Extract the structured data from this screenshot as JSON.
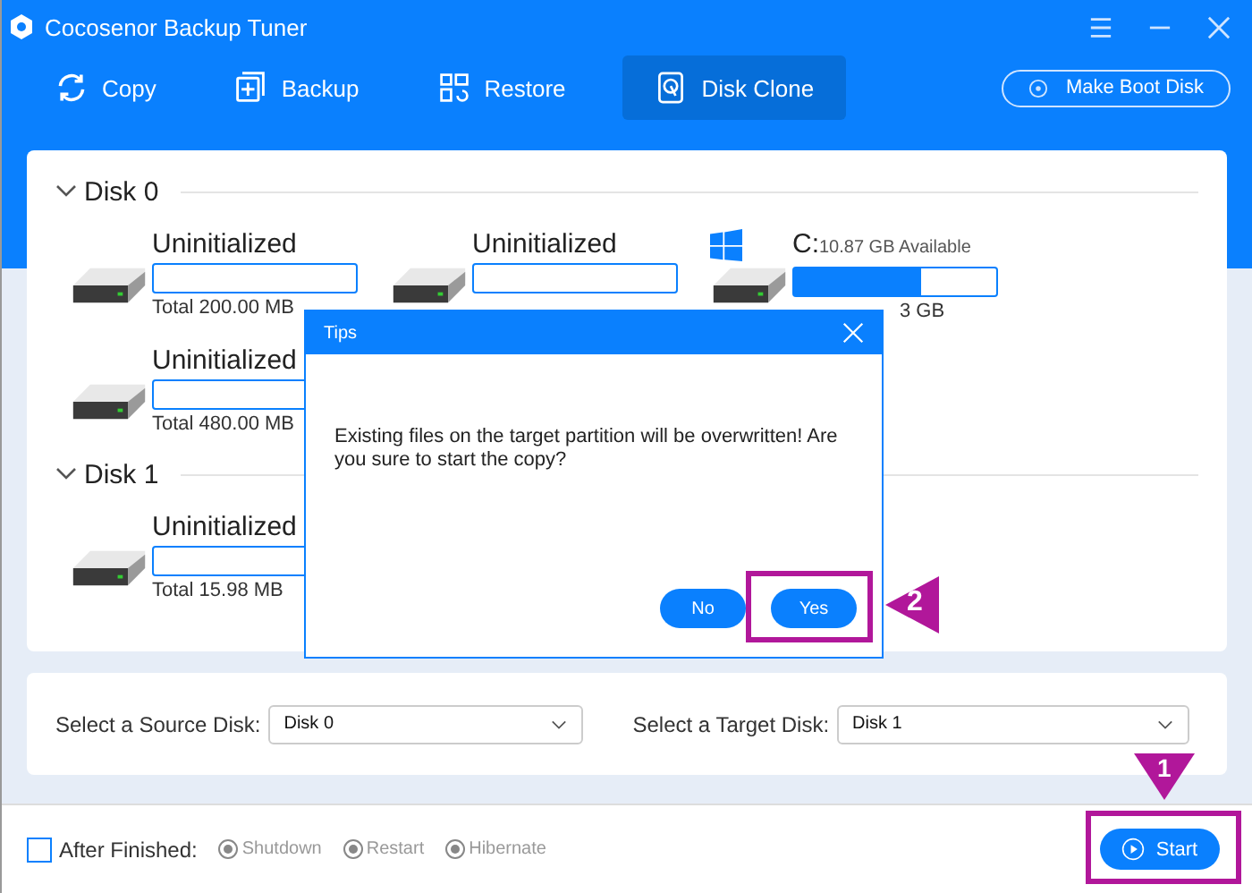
{
  "window": {
    "title": "Cocosenor Backup Tuner"
  },
  "tabs": [
    {
      "label": "Copy",
      "selected": false
    },
    {
      "label": "Backup",
      "selected": false
    },
    {
      "label": "Restore",
      "selected": false
    },
    {
      "label": "Disk Clone",
      "selected": true
    }
  ],
  "boot_button": "Make Boot Disk",
  "disks": [
    {
      "title": "Disk 0",
      "expanded": true,
      "partitions": [
        {
          "kind": "uninitialized",
          "name": "Uninitialized",
          "total": "Total 200.00 MB"
        },
        {
          "kind": "uninitialized",
          "name": "Uninitialized"
        },
        {
          "kind": "system",
          "name": "C:",
          "available": "10.87 GB Available",
          "level": 0.63,
          "total": "3 GB"
        },
        {
          "kind": "uninitialized",
          "name": "Uninitialized",
          "total": "Total 480.00 MB"
        }
      ]
    },
    {
      "title": "Disk 1",
      "expanded": true,
      "partitions": [
        {
          "kind": "uninitialized",
          "name": "Uninitialized",
          "total": "Total 15.98 MB"
        }
      ]
    }
  ],
  "selectors": [
    {
      "label": "Select a Source Disk:",
      "value": "Disk 0"
    },
    {
      "label": "Select a Target Disk:",
      "value": "Disk 1"
    }
  ],
  "footer": {
    "checkbox_label": "After Finished:",
    "checked": false,
    "options": [
      {
        "label": "Shutdown",
        "disabled": true
      },
      {
        "label": "Restart",
        "disabled": true
      },
      {
        "label": "Hibernate",
        "disabled": true
      }
    ],
    "start_button": "Start"
  },
  "dialog": {
    "title": "Tips",
    "message": "Existing files on the target partition will be overwritten! Are you sure to start the copy?",
    "buttons": [
      "No",
      "Yes"
    ]
  },
  "annotations": [
    {
      "label": "2"
    },
    {
      "label": "1"
    }
  ]
}
